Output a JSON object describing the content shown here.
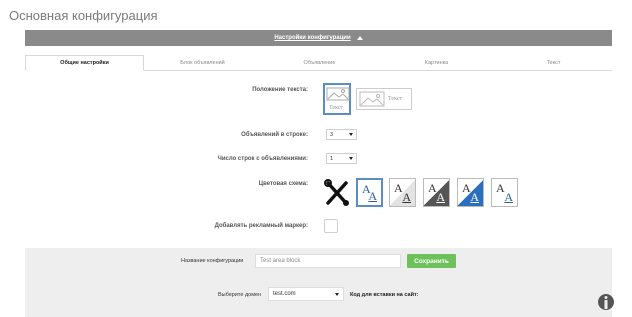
{
  "page": {
    "title": "Основная конфигурация"
  },
  "config_bar": {
    "title": "Настройки конфигурации"
  },
  "tabs": [
    {
      "label": "Общие настройки",
      "active": true
    },
    {
      "label": "Блок объявлений",
      "active": false
    },
    {
      "label": "Объявление",
      "active": false
    },
    {
      "label": "Картинка",
      "active": false
    },
    {
      "label": "Текст",
      "active": false
    }
  ],
  "settings": {
    "text_position": {
      "label": "Положение текста:",
      "option_text": "Текст"
    },
    "ads_per_row": {
      "label": "Объявлений в строке:",
      "value": "3"
    },
    "rows_count": {
      "label": "Число строк с объявлениями:",
      "value": "1"
    },
    "color_scheme": {
      "label": "Цветовая схема:",
      "letter": "A"
    },
    "ad_marker": {
      "label": "Добавлять рекламный маркер:"
    }
  },
  "footer": {
    "name_label": "Название конфигурации",
    "name_value": "Test area block",
    "save_label": "Сохранить",
    "domain_label": "Выберите домен",
    "domain_value": "test.com",
    "code_label": "Код для вставки на сайт:"
  },
  "colors": {
    "accent": "#5a8ec0",
    "save": "#6ec15a",
    "bar": "#8a8a8a"
  }
}
